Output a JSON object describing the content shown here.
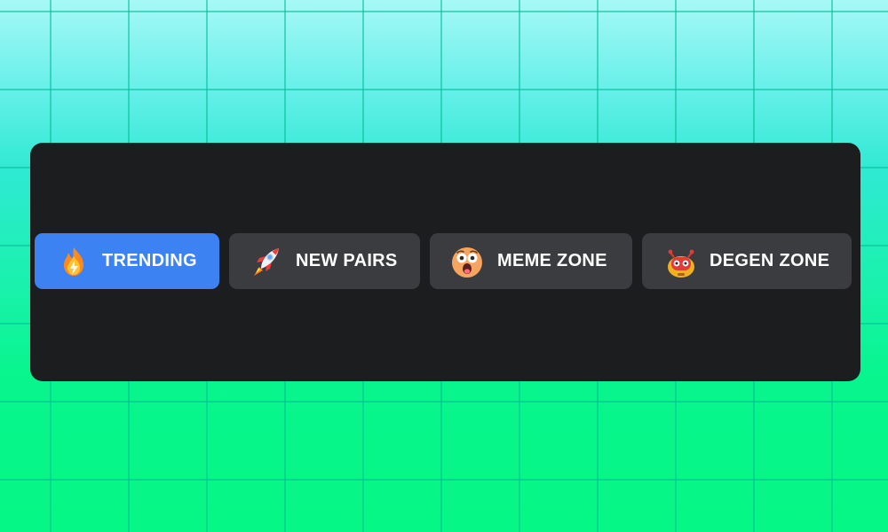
{
  "tabs": [
    {
      "label": "TRENDING",
      "icon": "fire-icon",
      "active": true
    },
    {
      "label": "NEW PAIRS",
      "icon": "rocket-icon",
      "active": false
    },
    {
      "label": "MEME ZONE",
      "icon": "surprised-face-icon",
      "active": false
    },
    {
      "label": "DEGEN ZONE",
      "icon": "robot-icon",
      "active": false
    }
  ],
  "colors": {
    "active_tab": "#3c82f2",
    "inactive_tab": "#3b3c3f",
    "panel": "#1c1d1f",
    "label": "#ffffff"
  }
}
